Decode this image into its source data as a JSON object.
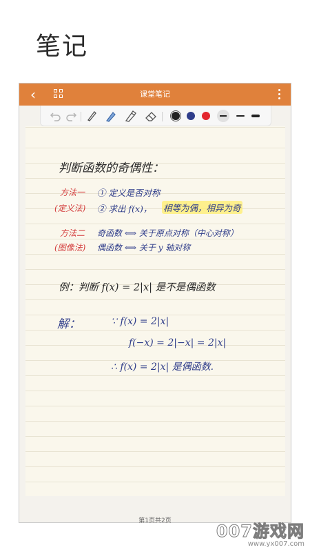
{
  "promo": {
    "title": "笔记"
  },
  "app_bar": {
    "title": "课堂笔记",
    "background": "#e0813b"
  },
  "toolbar": {
    "tools": [
      "undo-icon",
      "redo-icon",
      "pen-icon",
      "marker-icon",
      "highlighter-icon",
      "eraser-icon"
    ],
    "colors": [
      {
        "name": "black",
        "hex": "#222222",
        "selected": true
      },
      {
        "name": "blue",
        "hex": "#2f3d8a",
        "selected": false
      },
      {
        "name": "red",
        "hex": "#e3262e",
        "selected": false
      }
    ],
    "stroke_sizes": [
      "thin",
      "medium",
      "thick"
    ],
    "selected_stroke": "thin"
  },
  "note": {
    "heading": "判断函数的奇偶性：",
    "method1_label": "方法一",
    "method1_tag": "(定义法)",
    "method1_line1": "① 定义是否对称",
    "method1_line2": "② 求出 f(x)，",
    "method1_highlight": "相等为偶，相异为奇",
    "method2_label": "方法二",
    "method2_tag": "(图像法)",
    "method2_line1": "奇函数 ⟺ 关于原点对称（中心对称）",
    "method2_line2": "偶函数 ⟺ 关于 y 轴对称",
    "example": "例：判断 f(x) = 2|x| 是不是偶函数",
    "solution_label": "解：",
    "step1": "∵ f(x) = 2|x|",
    "step2": "f(−x) = 2|−x| = 2|x|",
    "step3": "∴ f(x) = 2|x| 是偶函数."
  },
  "page_indicator": "第1页共2页",
  "watermark": {
    "main": "007游戏网",
    "url": "www.yx007.com"
  }
}
